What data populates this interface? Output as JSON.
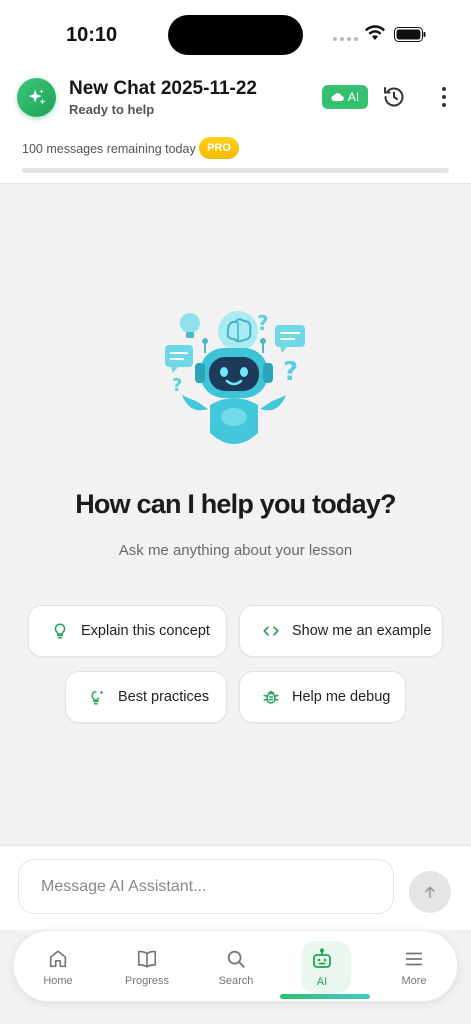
{
  "status_bar": {
    "time": "10:10"
  },
  "header": {
    "title": "New Chat 2025-11-22",
    "subtitle": "Ready to help",
    "ai_badge": "AI",
    "remaining": "100 messages remaining today",
    "pro_badge": "PRO",
    "accent": "#2fbf6a"
  },
  "main": {
    "title": "How can I help you today?",
    "subtitle": "Ask me anything about your lesson",
    "suggestions": [
      {
        "label": "Explain this concept",
        "icon": "lightbulb-icon"
      },
      {
        "label": "Show me an example",
        "icon": "code-icon"
      },
      {
        "label": "Best practices",
        "icon": "sparkle-bulb-icon"
      },
      {
        "label": "Help me debug",
        "icon": "bug-icon"
      }
    ]
  },
  "composer": {
    "placeholder": "Message AI Assistant..."
  },
  "tabs": [
    {
      "label": "Home",
      "icon": "home-icon"
    },
    {
      "label": "Progress",
      "icon": "book-icon"
    },
    {
      "label": "Search",
      "icon": "search-icon"
    },
    {
      "label": "AI",
      "icon": "robot-icon",
      "active": true
    },
    {
      "label": "More",
      "icon": "menu-icon"
    }
  ]
}
